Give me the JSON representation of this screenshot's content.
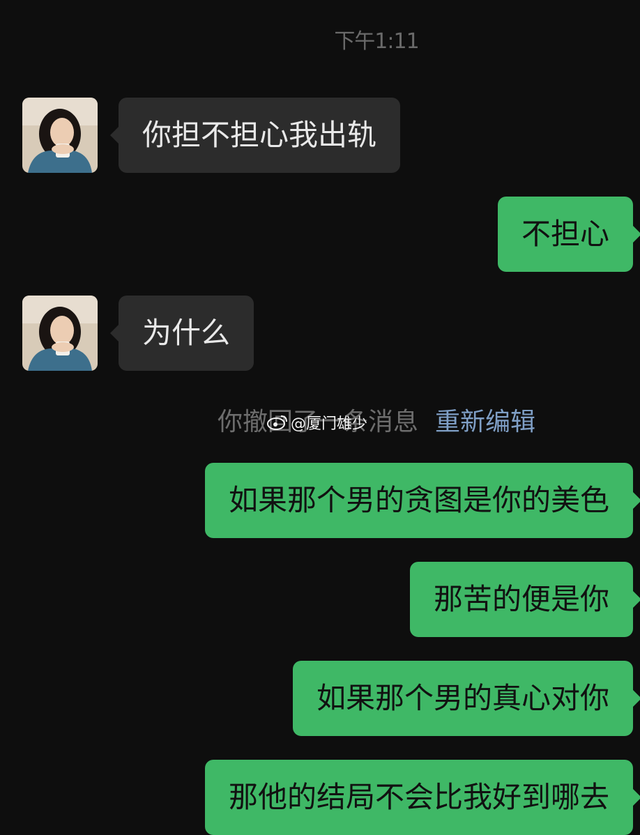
{
  "timestamp": "下午1:11",
  "messages": [
    {
      "from": "them",
      "text": "你担不担心我出轨"
    },
    {
      "from": "me",
      "text": "不担心"
    },
    {
      "from": "them",
      "text": "为什么"
    },
    {
      "from": "me",
      "text": "如果那个男的贪图是你的美色"
    },
    {
      "from": "me",
      "text": "那苦的便是你"
    },
    {
      "from": "me",
      "text": "如果那个男的真心对你"
    },
    {
      "from": "me",
      "text": "那他的结局不会比我好到哪去"
    }
  ],
  "recall_notice": {
    "text": "你撤回了一条消息",
    "edit_label": "重新编辑"
  },
  "watermark": "@厦门雄少",
  "colors": {
    "background": "#0e0e0e",
    "incoming_bubble": "#2c2c2c",
    "outgoing_bubble": "#3fb866",
    "edit_link": "#7f9fc6"
  }
}
